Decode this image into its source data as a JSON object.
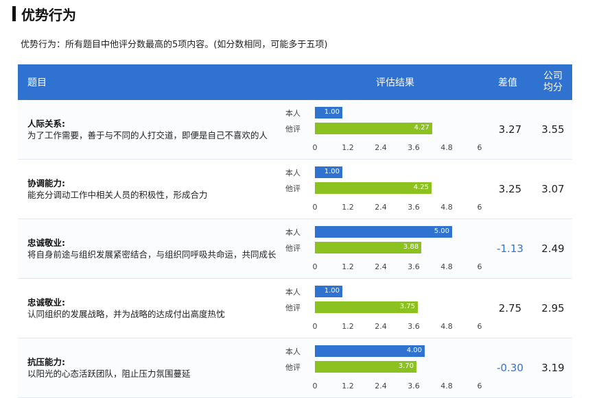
{
  "header": {
    "title": "优势行为",
    "subtitle": "优势行为：所有题目中他评分数最高的5项内容。(如分数相同，可能多于五项)"
  },
  "table": {
    "columns": {
      "topic": "题目",
      "result": "评估结果",
      "diff": "差值",
      "avg": "公司均分"
    },
    "series_labels": {
      "self": "本人",
      "other": "他评"
    },
    "axis_ticks": [
      "0",
      "1.2",
      "2.4",
      "3.6",
      "4.8",
      "6"
    ],
    "axis_max": 6,
    "colors": {
      "self": "#2f72d0",
      "other": "#8cc21f",
      "header": "#2f72d0"
    },
    "rows": [
      {
        "name": "人际关系:",
        "desc": "为了工作需要，善于与不同的人打交道，即便是自己不喜欢的人",
        "self": 1.0,
        "self_label": "1.00",
        "other": 4.27,
        "other_label": "4.27",
        "diff": "3.27",
        "avg": "3.55",
        "negative": false
      },
      {
        "name": "协调能力:",
        "desc": "能充分调动工作中相关人员的积极性，形成合力",
        "self": 1.0,
        "self_label": "1.00",
        "other": 4.25,
        "other_label": "4.25",
        "diff": "3.25",
        "avg": "3.07",
        "negative": false
      },
      {
        "name": "忠诚敬业:",
        "desc": "将自身前途与组织发展紧密结合，与组织同呼吸共命运，共同成长",
        "self": 5.0,
        "self_label": "5.00",
        "other": 3.88,
        "other_label": "3.88",
        "diff": "-1.13",
        "avg": "2.49",
        "negative": true
      },
      {
        "name": "忠诚敬业:",
        "desc": "认同组织的发展战略，并为战略的达成付出高度热忱",
        "self": 1.0,
        "self_label": "1.00",
        "other": 3.75,
        "other_label": "3.75",
        "diff": "2.75",
        "avg": "2.95",
        "negative": false
      },
      {
        "name": "抗压能力:",
        "desc": "以阳光的心态活跃团队，阻止压力氛围蔓延",
        "self": 4.0,
        "self_label": "4.00",
        "other": 3.7,
        "other_label": "3.70",
        "diff": "-0.30",
        "avg": "3.19",
        "negative": true
      }
    ]
  }
}
